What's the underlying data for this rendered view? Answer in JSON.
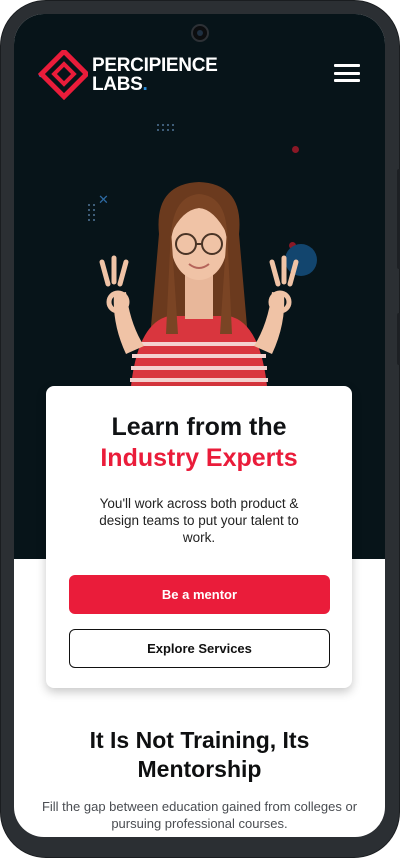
{
  "brand": {
    "line1": "PERCIPIENCE",
    "line2": "LABS",
    "dot": ".",
    "colors": {
      "accent": "#ea1c3a",
      "dark": "#071419",
      "blue": "#2a8fe0"
    }
  },
  "header": {
    "menu_icon": "hamburger-menu-icon"
  },
  "hero": {
    "title_line1": "Learn from the",
    "title_line2": "Industry Experts",
    "description": "You'll work across both product & design teams to put your talent to work.",
    "primary_button": "Be a mentor",
    "secondary_button": "Explore Services"
  },
  "section": {
    "title": "It Is Not Training, Its Mentorship",
    "description": "Fill the gap between education gained from colleges or pursuing professional courses."
  }
}
